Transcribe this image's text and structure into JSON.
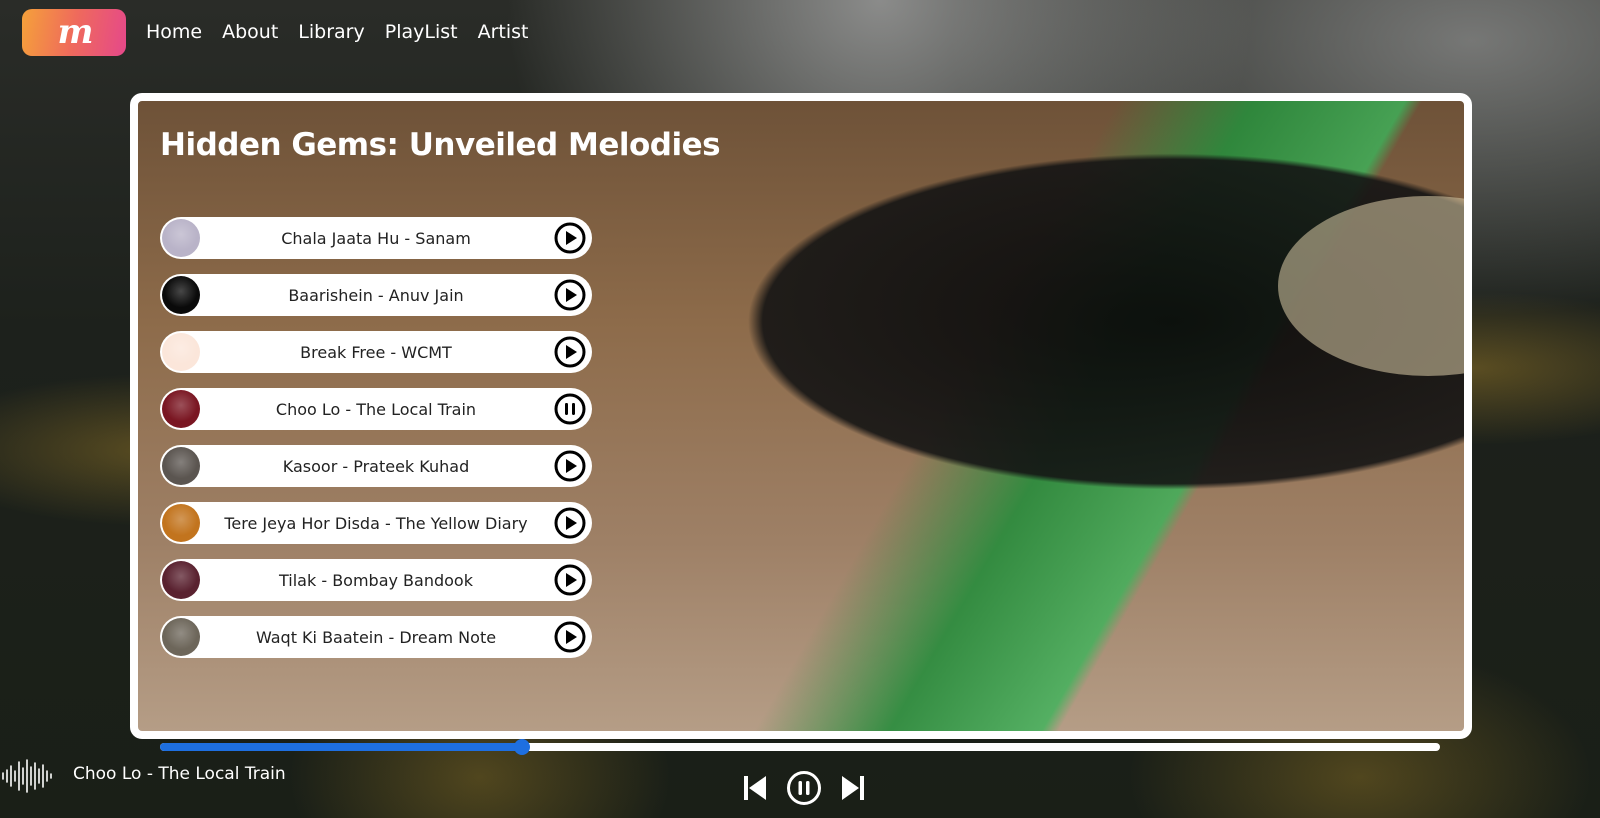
{
  "nav": {
    "logo_text": "m",
    "links": [
      "Home",
      "About",
      "Library",
      "PlayList",
      "Artist"
    ]
  },
  "playlist": {
    "title": "Hidden Gems: Unveiled Melodies",
    "songs": [
      {
        "title": "Chala Jaata Hu - Sanam",
        "state": "play",
        "thumb_color": "#b9b3c8"
      },
      {
        "title": "Baarishein - Anuv Jain",
        "state": "play",
        "thumb_color": "#0a0a0a"
      },
      {
        "title": "Break Free - WCMT",
        "state": "play",
        "thumb_color": "#fbe6da"
      },
      {
        "title": "Choo Lo - The Local Train",
        "state": "pause",
        "thumb_color": "#7a1622"
      },
      {
        "title": "Kasoor - Prateek Kuhad",
        "state": "play",
        "thumb_color": "#5b5550"
      },
      {
        "title": "Tere Jeya Hor Disda - The Yellow Diary",
        "state": "play",
        "thumb_color": "#c2741e"
      },
      {
        "title": "Tilak - Bombay Bandook",
        "state": "play",
        "thumb_color": "#5a2230"
      },
      {
        "title": "Waqt Ki Baatein - Dream Note",
        "state": "play",
        "thumb_color": "#6d665a"
      }
    ]
  },
  "player": {
    "now_playing": "Choo Lo - The Local Train",
    "progress_percent": 28.3,
    "accent_color": "#1e6fe0"
  },
  "icons": {
    "play": "play-circle-icon",
    "pause": "pause-circle-icon",
    "prev": "skip-previous-icon",
    "next": "skip-next-icon",
    "wave": "soundwave-icon"
  }
}
